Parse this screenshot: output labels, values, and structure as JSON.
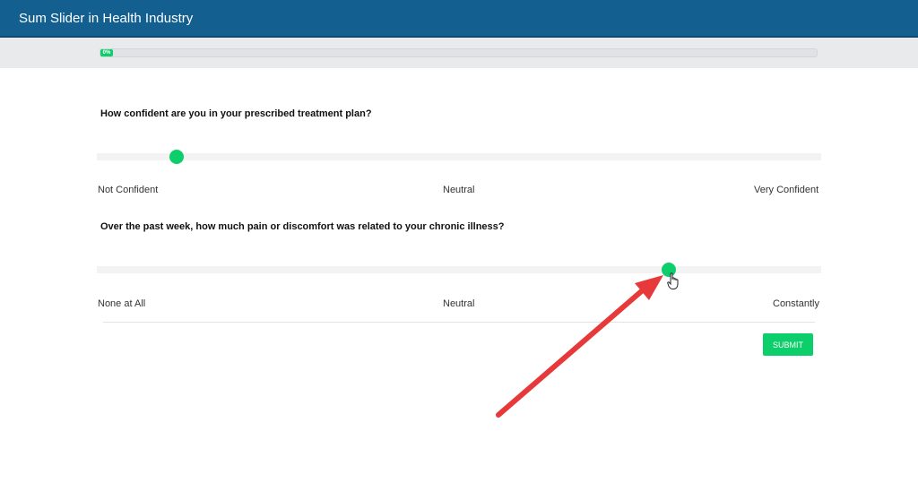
{
  "header": {
    "title": "Sum Slider in Health Industry"
  },
  "progress": {
    "label": "0%",
    "value": 0
  },
  "questions": [
    {
      "text": "How confident are you in your prescribed treatment plan?",
      "value": 0.11,
      "labels": [
        "Not Confident",
        "Neutral",
        "Very Confident"
      ]
    },
    {
      "text": "Over the past week, how much pain or discomfort was related to your chronic illness?",
      "value": 0.79,
      "labels": [
        "None at All",
        "Neutral",
        "Constantly"
      ]
    }
  ],
  "submit": {
    "label": "SUBMIT"
  },
  "colors": {
    "header": "#135f8f",
    "accent": "#0cce6b",
    "annotation": "#e8393a"
  }
}
